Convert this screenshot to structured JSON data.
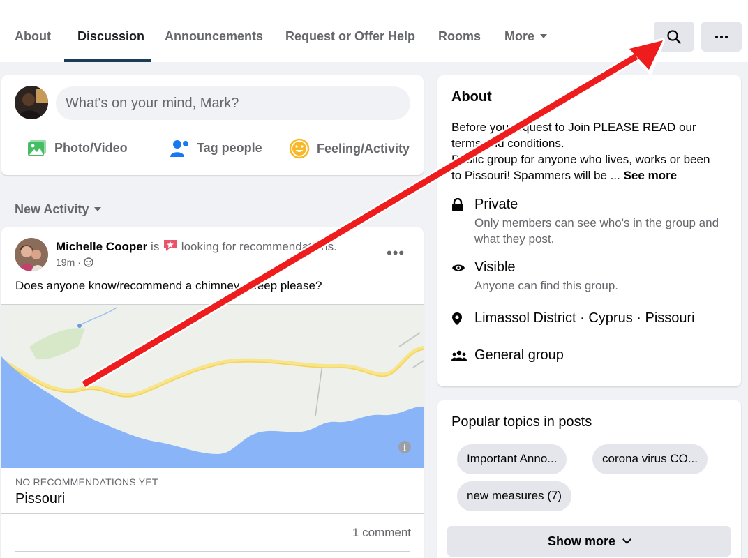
{
  "nav": {
    "tabs": [
      {
        "label": "About"
      },
      {
        "label": "Discussion",
        "active": true
      },
      {
        "label": "Announcements"
      },
      {
        "label": "Request or Offer Help"
      },
      {
        "label": "Rooms"
      },
      {
        "label": "More"
      }
    ],
    "search_icon": "search-icon",
    "more_icon": "ellipsis-icon"
  },
  "composer": {
    "placeholder": "What's on your mind, Mark?",
    "actions": [
      {
        "label": "Photo/Video",
        "icon": "photo-icon",
        "color": "#45bd62"
      },
      {
        "label": "Tag people",
        "icon": "tag-people-icon",
        "color": "#1877f2"
      },
      {
        "label": "Feeling/Activity",
        "icon": "feeling-icon",
        "color": "#f7b928"
      }
    ]
  },
  "feed": {
    "sort_label": "New Activity"
  },
  "post": {
    "author": "Michelle Cooper",
    "verb": "is",
    "activity": "looking for recommendations.",
    "time": "19m",
    "audience_icon": "globe-icon",
    "text": "Does anyone know/recommend a chimney sweep please?",
    "recommendation_label": "NO RECOMMENDATIONS YET",
    "place": "Pissouri",
    "comment_count": "1 comment"
  },
  "about": {
    "title": "About",
    "description_line1": "Before you request to Join PLEASE READ our",
    "description_line2": "terms and conditions.",
    "description_line3": "Public group for anyone who lives, works or been",
    "description_line4": "to Pissouri! Spammers will be ...",
    "see_more": "See more",
    "private_title": "Private",
    "private_sub": "Only members can see who's in the group and what they post.",
    "visible_title": "Visible",
    "visible_sub": "Anyone can find this group.",
    "location": "Limassol District · Cyprus · Pissouri",
    "group_type": "General group"
  },
  "topics": {
    "title": "Popular topics in posts",
    "chips": [
      "Important Anno...",
      "corona virus CO...",
      "new measures (7)"
    ],
    "show_more": "Show more"
  },
  "colors": {
    "accent": "#1877f2",
    "annotation_arrow": "#ee1c1c",
    "map_water": "#8ab4f8",
    "map_road": "#f8e48a"
  }
}
